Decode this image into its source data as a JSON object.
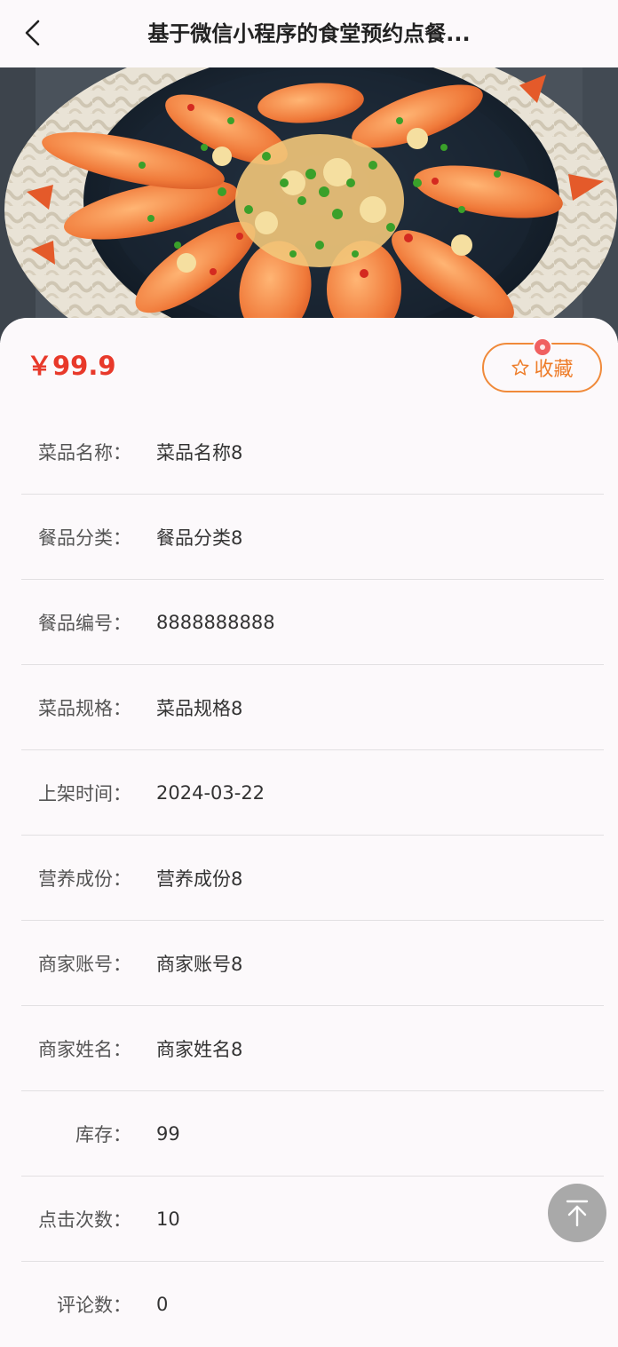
{
  "nav": {
    "title": "基于微信小程序的食堂预约点餐..."
  },
  "product": {
    "price": "￥99.9",
    "favorite_label": "收藏"
  },
  "details": [
    {
      "label": "菜品名称：",
      "value": "菜品名称8"
    },
    {
      "label": "餐品分类：",
      "value": "餐品分类8"
    },
    {
      "label": "餐品编号：",
      "value": "8888888888"
    },
    {
      "label": "菜品规格：",
      "value": "菜品规格8"
    },
    {
      "label": "上架时间：",
      "value": "2024-03-22"
    },
    {
      "label": "营养成份：",
      "value": "营养成份8"
    },
    {
      "label": "商家账号：",
      "value": "商家账号8"
    },
    {
      "label": "商家姓名：",
      "value": "商家姓名8"
    },
    {
      "label": "库存：",
      "value": "99"
    },
    {
      "label": "点击次数：",
      "value": "10"
    },
    {
      "label": "评论数：",
      "value": "0"
    }
  ],
  "icons": {
    "back": "chevron-left-icon",
    "favorite": "star-outline-icon",
    "to_top": "arrow-up-to-top-icon"
  },
  "colors": {
    "price": "#e8392a",
    "favorite_border": "#f08a3a",
    "favorite_text": "#ee7d2a",
    "to_top_bg": "#a9a9a9",
    "page_bg": "#fcf9fb"
  }
}
